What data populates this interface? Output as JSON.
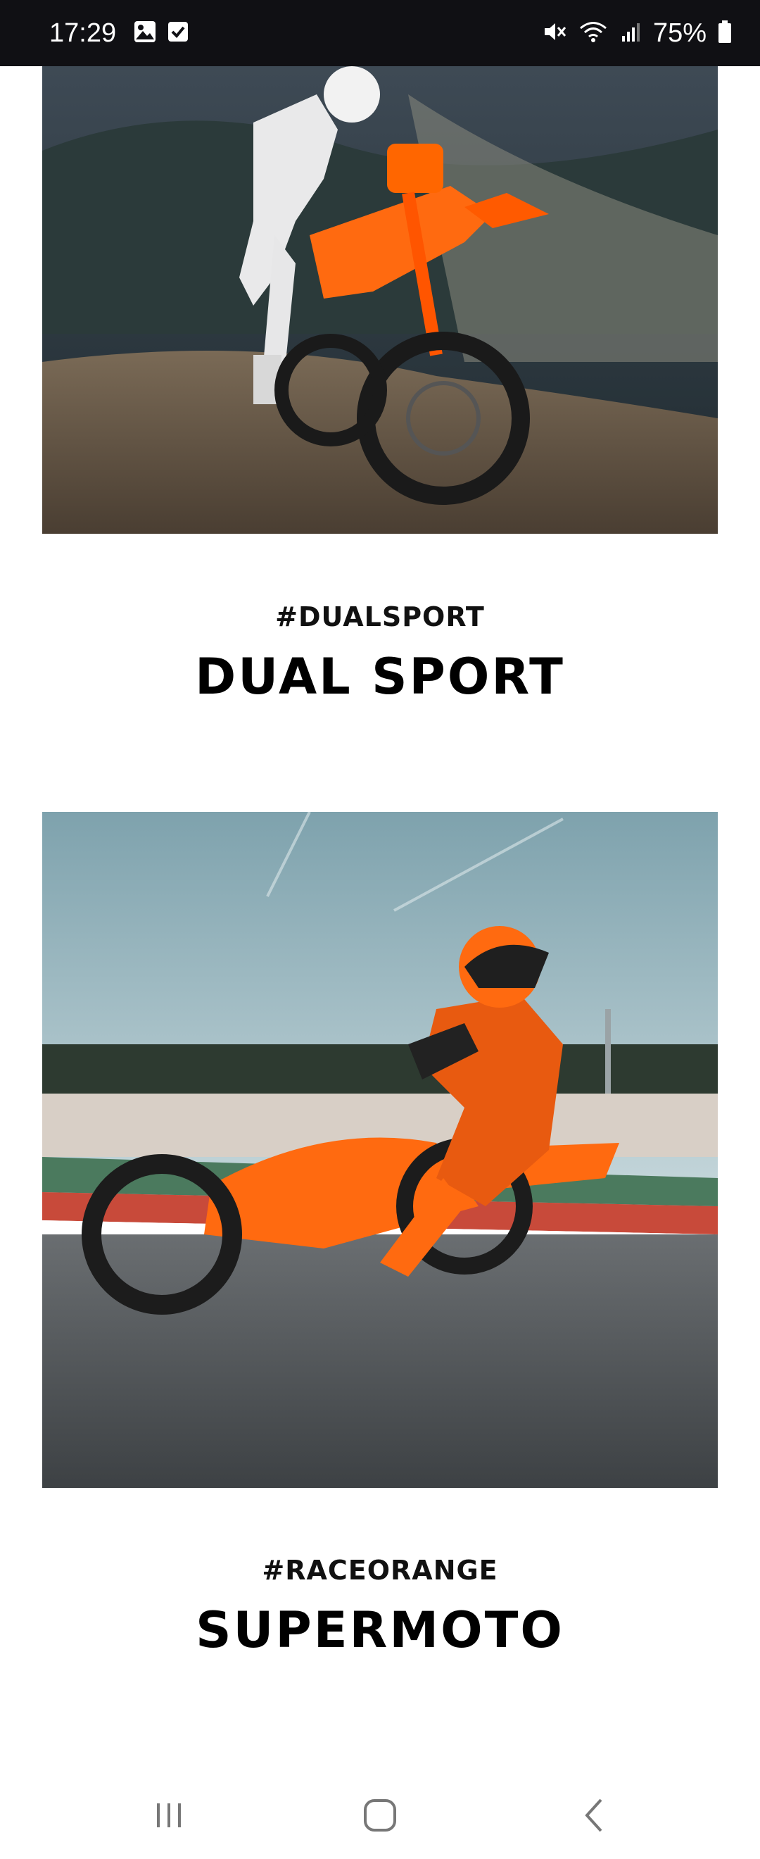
{
  "status_bar": {
    "time": "17:29",
    "left_icons": [
      "gallery-icon",
      "checkbox-notification-icon"
    ],
    "right_icons": [
      "mute-icon",
      "wifi-icon",
      "signal-icon",
      "battery-icon"
    ],
    "battery": "75%"
  },
  "cards": [
    {
      "image": "dual-sport-motorcycle-photo",
      "tag": "",
      "title": ""
    },
    {
      "image": "dual-sport-motorcycle-photo",
      "tag": "#DUALSPORT",
      "title": "DUAL SPORT"
    },
    {
      "image": "supermoto-motorcycle-photo",
      "tag": "#RACEORANGE",
      "title": "SUPERMOTO"
    }
  ],
  "nav_bar": {
    "buttons": [
      "recent-apps-icon",
      "home-icon",
      "back-icon"
    ]
  },
  "colors": {
    "accent": "#ff6600",
    "status_bar_bg": "#101014",
    "text": "#000000"
  }
}
